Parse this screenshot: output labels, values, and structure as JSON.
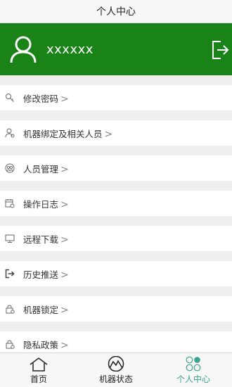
{
  "header": {
    "title": "个人中心"
  },
  "profile": {
    "username": "xxxxxx",
    "avatar_icon": "user-icon",
    "logout_icon": "logout-icon"
  },
  "menu": [
    {
      "label": "修改密码",
      "icon": "key-icon"
    },
    {
      "label": "机器绑定及相关人员",
      "icon": "user-settings-icon"
    },
    {
      "label": "人员管理",
      "icon": "people-icon"
    },
    {
      "label": "操作日志",
      "icon": "calendar-log-icon"
    },
    {
      "label": "远程下载",
      "icon": "monitor-icon"
    },
    {
      "label": "历史推送",
      "icon": "exit-arrow-icon"
    },
    {
      "label": "机器锁定",
      "icon": "lock-icon"
    },
    {
      "label": "隐私政策",
      "icon": "privacy-lock-icon"
    }
  ],
  "tabs": [
    {
      "label": "首页",
      "icon": "home-icon"
    },
    {
      "label": "机器状态",
      "icon": "mountain-status-icon"
    },
    {
      "label": "个人中心",
      "icon": "dots-grid-icon",
      "active": true
    }
  ],
  "colors": {
    "header_green": "#1a8318",
    "active_tab": "#3aa38d"
  }
}
